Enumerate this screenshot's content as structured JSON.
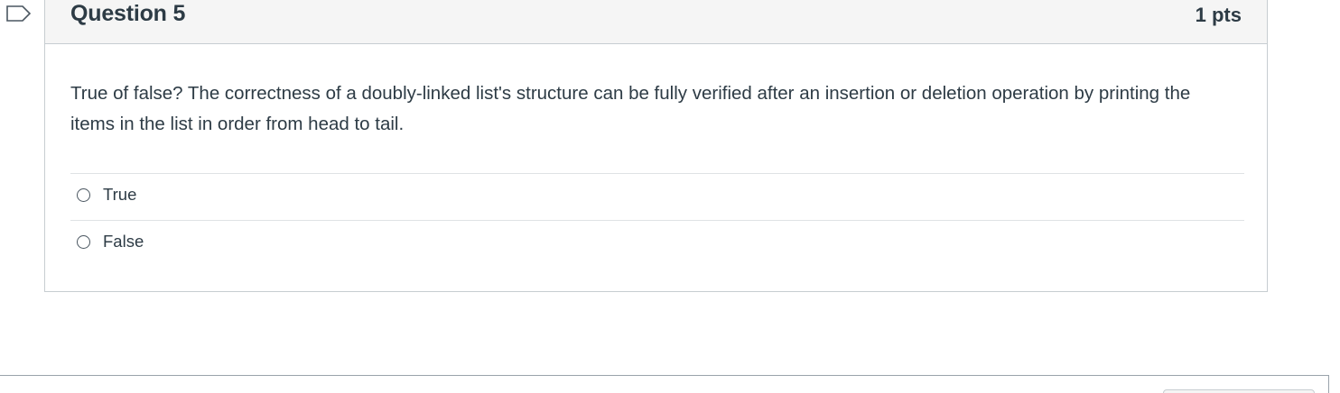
{
  "question": {
    "title": "Question 5",
    "points": "1 pts",
    "text": "True of false?  The correctness of a doubly-linked list's structure can be fully verified after an insertion or deletion operation by printing the items in the list in order from head to tail."
  },
  "answers": [
    {
      "label": "True",
      "selected": false
    },
    {
      "label": "False",
      "selected": false
    }
  ],
  "icons": {
    "flag": "flag-icon"
  }
}
